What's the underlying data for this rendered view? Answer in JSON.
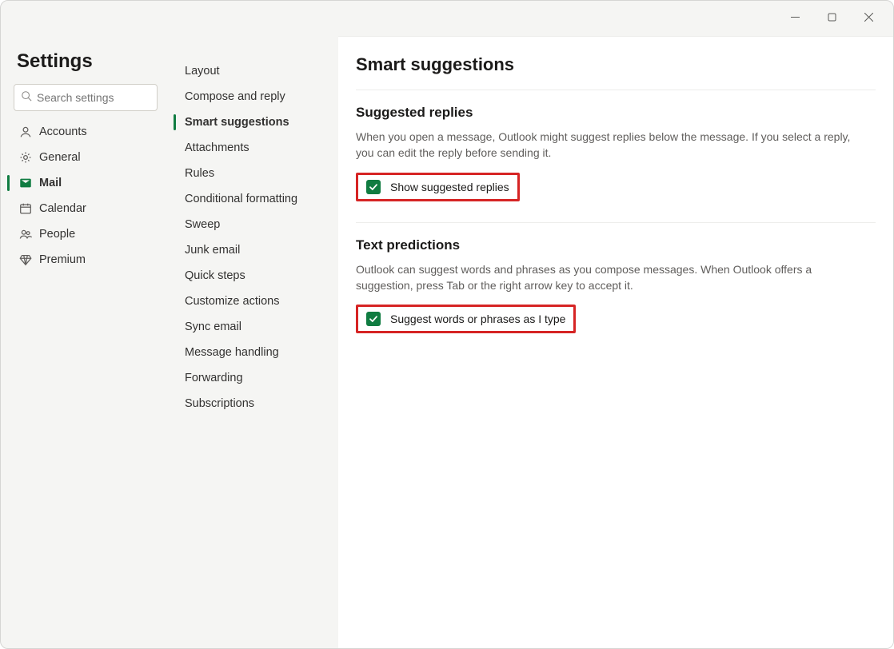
{
  "window": {
    "title": "Settings"
  },
  "search": {
    "placeholder": "Search settings"
  },
  "leftNav": {
    "items": [
      {
        "id": "accounts",
        "label": "Accounts",
        "active": false
      },
      {
        "id": "general",
        "label": "General",
        "active": false
      },
      {
        "id": "mail",
        "label": "Mail",
        "active": true
      },
      {
        "id": "calendar",
        "label": "Calendar",
        "active": false
      },
      {
        "id": "people",
        "label": "People",
        "active": false
      },
      {
        "id": "premium",
        "label": "Premium",
        "active": false
      }
    ]
  },
  "subNav": {
    "items": [
      {
        "id": "layout",
        "label": "Layout",
        "active": false
      },
      {
        "id": "compose-reply",
        "label": "Compose and reply",
        "active": false
      },
      {
        "id": "smart-suggestions",
        "label": "Smart suggestions",
        "active": true
      },
      {
        "id": "attachments",
        "label": "Attachments",
        "active": false
      },
      {
        "id": "rules",
        "label": "Rules",
        "active": false
      },
      {
        "id": "conditional-formatting",
        "label": "Conditional formatting",
        "active": false
      },
      {
        "id": "sweep",
        "label": "Sweep",
        "active": false
      },
      {
        "id": "junk-email",
        "label": "Junk email",
        "active": false
      },
      {
        "id": "quick-steps",
        "label": "Quick steps",
        "active": false
      },
      {
        "id": "customize-actions",
        "label": "Customize actions",
        "active": false
      },
      {
        "id": "sync-email",
        "label": "Sync email",
        "active": false
      },
      {
        "id": "message-handling",
        "label": "Message handling",
        "active": false
      },
      {
        "id": "forwarding",
        "label": "Forwarding",
        "active": false
      },
      {
        "id": "subscriptions",
        "label": "Subscriptions",
        "active": false
      }
    ]
  },
  "content": {
    "heading": "Smart suggestions",
    "sections": [
      {
        "id": "suggested-replies",
        "title": "Suggested replies",
        "description": "When you open a message, Outlook might suggest replies below the message. If you select a reply, you can edit the reply before sending it.",
        "checkbox": {
          "label": "Show suggested replies",
          "checked": true
        }
      },
      {
        "id": "text-predictions",
        "title": "Text predictions",
        "description": "Outlook can suggest words and phrases as you compose messages. When Outlook offers a suggestion, press Tab or the right arrow key to accept it.",
        "checkbox": {
          "label": "Suggest words or phrases as I type",
          "checked": true
        }
      }
    ]
  },
  "colors": {
    "accent": "#107c41",
    "highlight": "#d62424"
  }
}
